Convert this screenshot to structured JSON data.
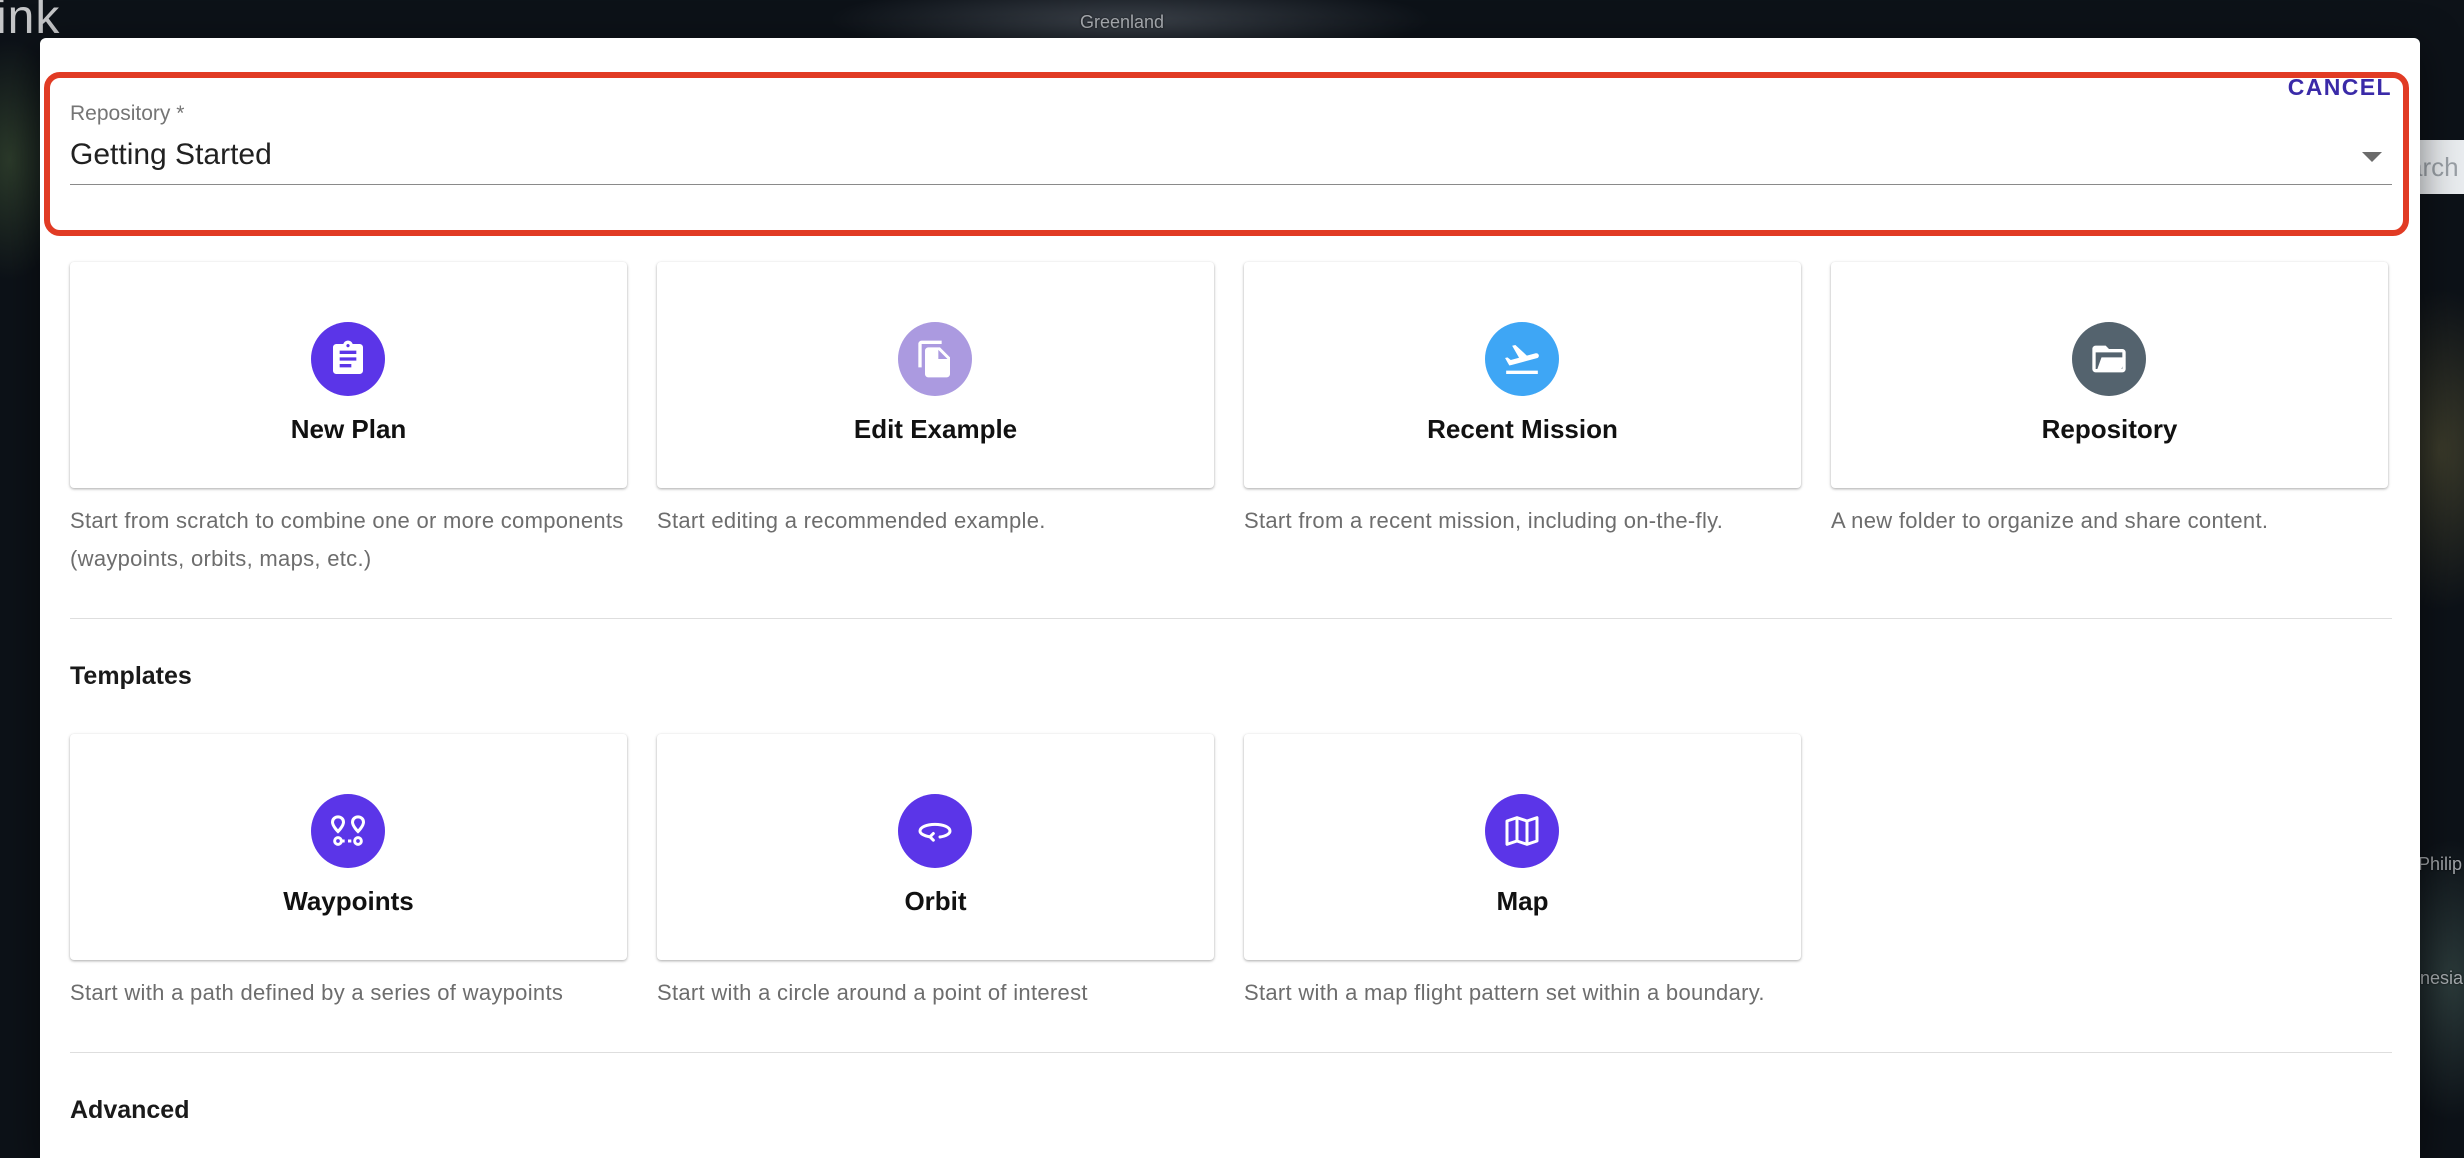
{
  "background": {
    "brand_fragment": "ink",
    "map_labels": [
      "Greenland",
      "Philip",
      "nesia"
    ],
    "search_fragment": "arch"
  },
  "dialog": {
    "cancel_label": "CANCEL",
    "repository": {
      "label": "Repository *",
      "value": "Getting Started"
    },
    "create_options": [
      {
        "title": "New Plan",
        "description": "Start from scratch to combine one or more components (waypoints, orbits, maps, etc.)",
        "icon": "clipboard-icon",
        "color": "#5b35e8"
      },
      {
        "title": "Edit Example",
        "description": "Start editing a recommended example.",
        "icon": "copy-file-icon",
        "color": "#ab9ae0"
      },
      {
        "title": "Recent Mission",
        "description": "Start from a recent mission, including on-the-fly.",
        "icon": "plane-takeoff-icon",
        "color": "#3ea6f5"
      },
      {
        "title": "Repository",
        "description": "A new folder to organize and share content.",
        "icon": "folder-open-icon",
        "color": "#54636e"
      }
    ],
    "templates": {
      "title": "Templates",
      "items": [
        {
          "title": "Waypoints",
          "description": "Start with a path defined by a series of waypoints",
          "icon": "waypoints-icon",
          "color": "#5b35e8"
        },
        {
          "title": "Orbit",
          "description": "Start with a circle around a point of interest",
          "icon": "orbit-icon",
          "color": "#5b35e8"
        },
        {
          "title": "Map",
          "description": "Start with a map flight pattern set within a boundary.",
          "icon": "map-icon",
          "color": "#5b35e8"
        }
      ]
    },
    "advanced": {
      "title": "Advanced"
    }
  }
}
